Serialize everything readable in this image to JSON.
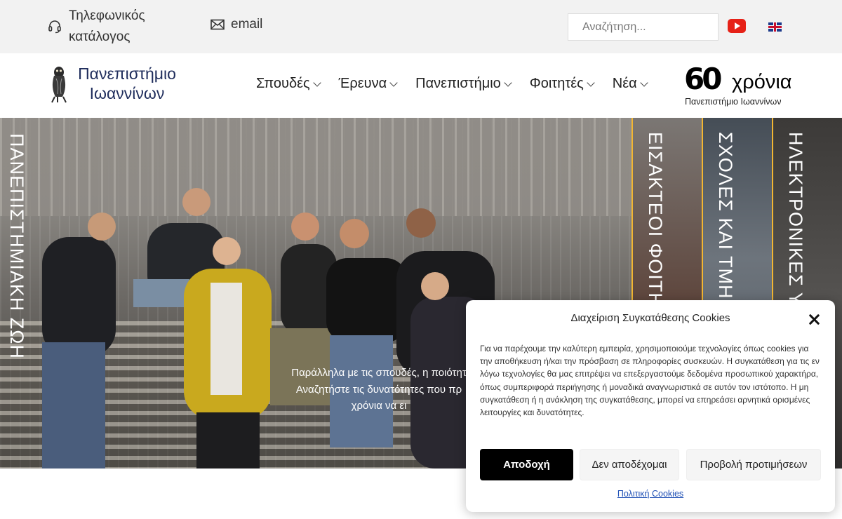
{
  "topbar": {
    "phone_label": "Τηλεφωνικός κατάλογος",
    "email_label": "email",
    "search_placeholder": "Αναζήτηση...",
    "youtube_icon": "youtube-icon",
    "language_icon": "uk-flag-icon"
  },
  "header": {
    "logo_text": "Πανεπιστήμιο Ιωαννίνων",
    "nav": [
      {
        "label": "Σπουδές"
      },
      {
        "label": "Έρευνα"
      },
      {
        "label": "Πανεπιστήμιο"
      },
      {
        "label": "Φοιτητές"
      },
      {
        "label": "Νέα"
      }
    ],
    "anniversary": {
      "number": "60",
      "word": "χρόνια",
      "subtitle": "Πανεπιστήμιο Ιωαννίνων"
    }
  },
  "hero": {
    "vertical_title": "ΠΑΝΕΠΙΣΤΗΜΙΑΚΗ ΖΩΗ",
    "text_line1": "Παράλληλα με τις σπουδές, η ποιότητ",
    "text_line2": "Αναζητήστε τις δυνατότητες που πρ",
    "text_line3": "χρόνια να ει",
    "panels": [
      {
        "label": "ΕΙΣΑΚΤΕΟΙ ΦΟΙΤΗΤ"
      },
      {
        "label": "ΣΧΟΛΕΣ ΚΑΙ ΤΜΗΜ"
      },
      {
        "label": "ΗΛΕΚΤΡΟΝΙΚΕΣ ΥΠ"
      }
    ],
    "accent_color": "#f2b632"
  },
  "cookie_dialog": {
    "title": "Διαχείριση Συγκατάθεσης Cookies",
    "body": "Για να παρέχουμε την καλύτερη εμπειρία, χρησιμοποιούμε τεχνολογίες όπως cookies για την αποθήκευση ή/και την πρόσβαση σε πληροφορίες συσκευών. Η συγκατάθεση για τις εν λόγω τεχνολογίες θα μας επιτρέψει να επεξεργαστούμε δεδομένα προσωπικού χαρακτήρα, όπως συμπεριφορά περιήγησης ή μοναδικά αναγνωριστικά σε αυτόν τον ιστότοπο. Η μη συγκατάθεση ή η ανάκληση της συγκατάθεσης, μπορεί να επηρεάσει αρνητικά ορισμένες λειτουργίες και δυνατότητες.",
    "accept_label": "Αποδοχή",
    "deny_label": "Δεν αποδέχομαι",
    "prefs_label": "Προβολή προτιμήσεων",
    "policy_link": "Πολιτική Cookies"
  }
}
